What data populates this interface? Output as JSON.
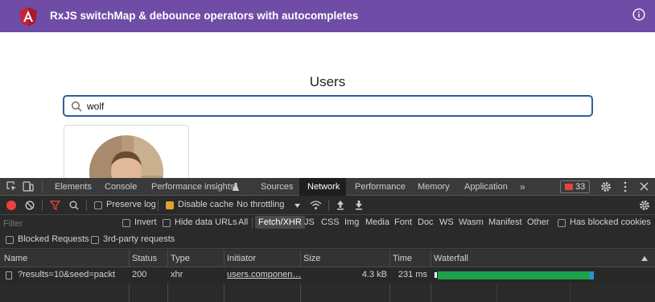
{
  "app": {
    "title": "RxJS switchMap & debounce operators with autocompletes",
    "brand_color": "#6f4ca5"
  },
  "page": {
    "heading": "Users",
    "search_value": "wolf"
  },
  "devtools": {
    "tabs": [
      "Elements",
      "Console",
      "Performance insights",
      "Sources",
      "Network",
      "Performance",
      "Memory",
      "Application",
      "»"
    ],
    "active_tab": "Network",
    "error_count": "33",
    "toolbar": {
      "preserve_log": "Preserve log",
      "disable_cache": "Disable cache",
      "throttling": "No throttling"
    },
    "filter": {
      "placeholder": "Filter",
      "invert": "Invert",
      "hide_data_urls": "Hide data URLs",
      "types": [
        "All",
        "Fetch/XHR",
        "JS",
        "CSS",
        "Img",
        "Media",
        "Font",
        "Doc",
        "WS",
        "Wasm",
        "Manifest",
        "Other"
      ],
      "active_type": "Fetch/XHR",
      "has_blocked_cookies": "Has blocked cookies",
      "blocked_requests": "Blocked Requests",
      "third_party": "3rd-party requests"
    },
    "table": {
      "columns": [
        "Name",
        "Status",
        "Type",
        "Initiator",
        "Size",
        "Time",
        "Waterfall"
      ],
      "rows": [
        {
          "name": "?results=10&seed=packt",
          "status": "200",
          "type": "xhr",
          "initiator": "users.componen…",
          "size": "4.3 kB",
          "time": "231 ms",
          "waterfall_fraction": 0.7
        }
      ]
    }
  }
}
